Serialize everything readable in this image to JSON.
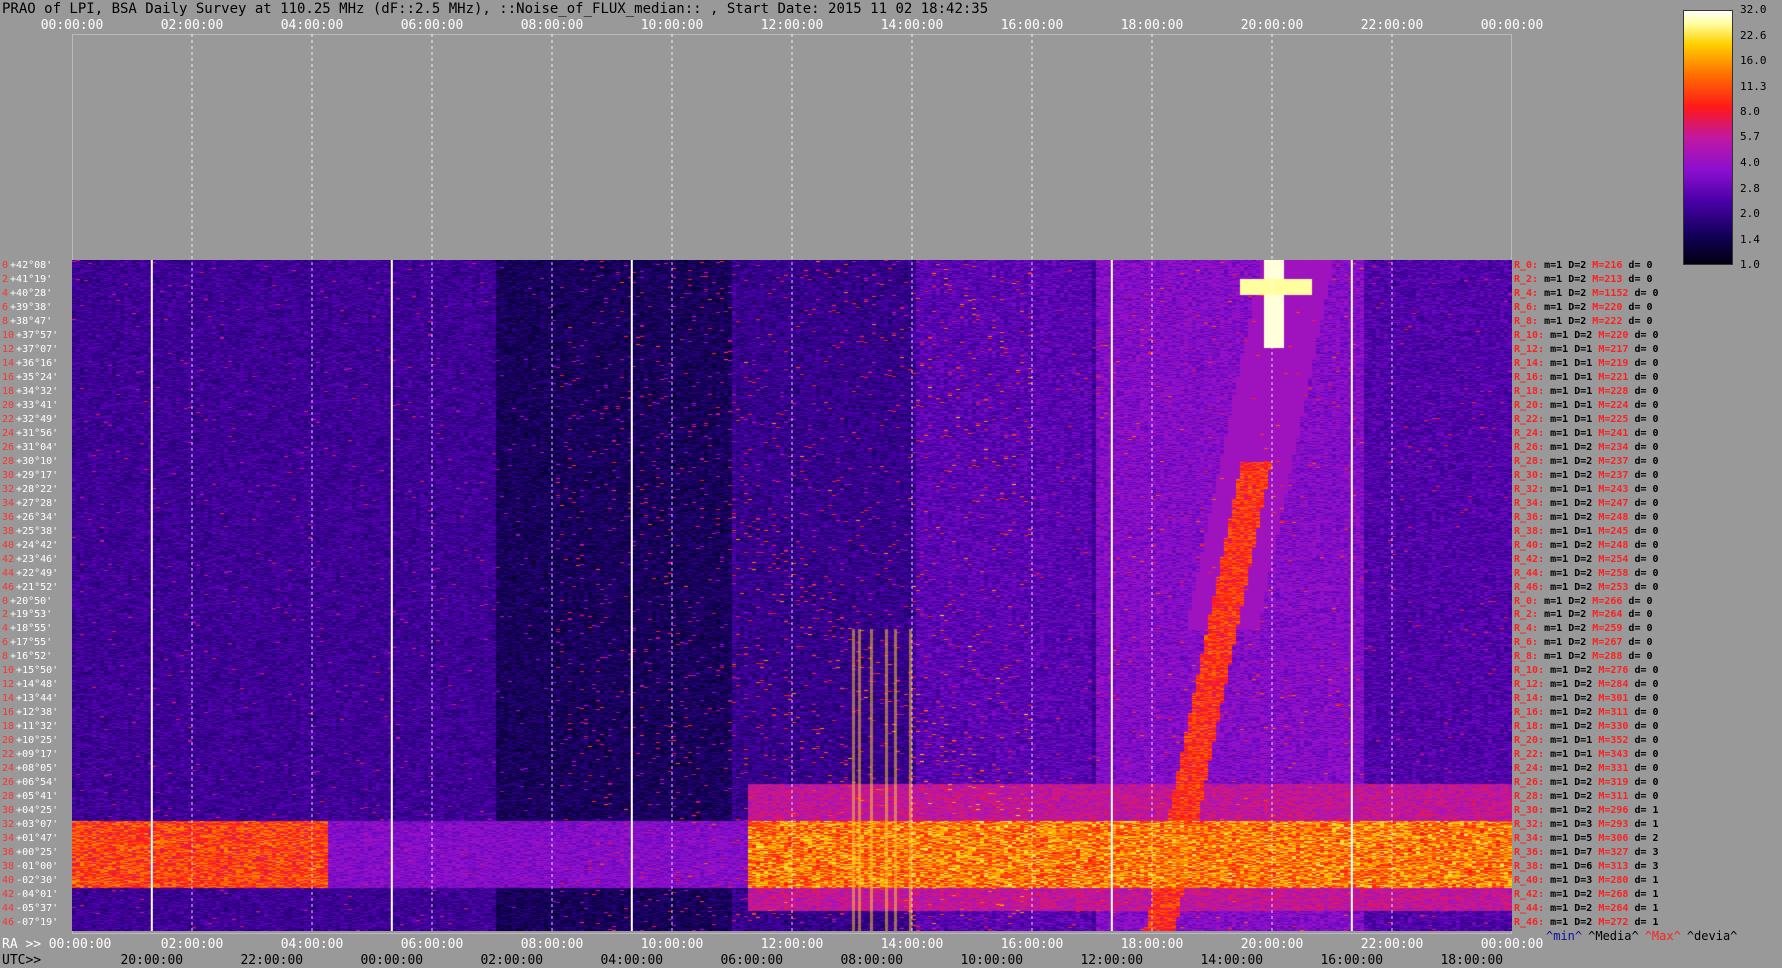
{
  "title": "PRAO of LPI, BSA Daily Survey at 110.25 MHz (dF::2.5 MHz), ::Noise_of_FLUX_median:: , Start Date: 2015 11 02 18:42:35",
  "chart_data": {
    "type": "heatmap",
    "title": "PRAO of LPI, BSA Daily Survey at 110.25 MHz (dF::2.5 MHz), ::Noise_of_FLUX_median:: , Start Date: 2015 11 02 18:42:35",
    "x_top_ticks": [
      "00:00:00",
      "02:00:00",
      "04:00:00",
      "06:00:00",
      "08:00:00",
      "10:00:00",
      "12:00:00",
      "14:00:00",
      "16:00:00",
      "18:00:00",
      "20:00:00",
      "22:00:00",
      "00:00:00"
    ],
    "ra_label": "RA >>",
    "ra_ticks": [
      "00:00:00",
      "02:00:00",
      "04:00:00",
      "06:00:00",
      "08:00:00",
      "10:00:00",
      "12:00:00",
      "14:00:00",
      "16:00:00",
      "18:00:00",
      "20:00:00",
      "22:00:00",
      "00:00:00"
    ],
    "utc_label": "UTC>>",
    "utc_ticks": [
      "20:00:00",
      "22:00:00",
      "00:00:00",
      "02:00:00",
      "04:00:00",
      "06:00:00",
      "08:00:00",
      "10:00:00",
      "12:00:00",
      "14:00:00",
      "16:00:00",
      "18:00:00"
    ],
    "colorbar_ticks": [
      "32.0",
      "22.6",
      "16.0",
      "11.3",
      "8.0",
      "5.7",
      "4.0",
      "2.8",
      "2.0",
      "1.4",
      "1.0"
    ],
    "colorbar_scale": "log",
    "colorbar_range": [
      1.0,
      32.0
    ],
    "rays": [
      {
        "idx": "0",
        "dec": "+42°08'",
        "r": "R_0:",
        "m": "m=1",
        "d": "D=2",
        "mh": "M=216",
        "dv": "d= 0"
      },
      {
        "idx": "2",
        "dec": "+41°19'",
        "r": "R_2:",
        "m": "m=1",
        "d": "D=2",
        "mh": "M=213",
        "dv": "d= 0"
      },
      {
        "idx": "4",
        "dec": "+40°28'",
        "r": "R_4:",
        "m": "m=1",
        "d": "D=2",
        "mh": "M=1152",
        "dv": "d= 0"
      },
      {
        "idx": "6",
        "dec": "+39°38'",
        "r": "R_6:",
        "m": "m=1",
        "d": "D=2",
        "mh": "M=220",
        "dv": "d= 0"
      },
      {
        "idx": "8",
        "dec": "+38°47'",
        "r": "R_8:",
        "m": "m=1",
        "d": "D=2",
        "mh": "M=222",
        "dv": "d= 0"
      },
      {
        "idx": "10",
        "dec": "+37°57'",
        "r": "R_10:",
        "m": "m=1",
        "d": "D=2",
        "mh": "M=220",
        "dv": "d= 0"
      },
      {
        "idx": "12",
        "dec": "+37°07'",
        "r": "R_12:",
        "m": "m=1",
        "d": "D=1",
        "mh": "M=217",
        "dv": "d= 0"
      },
      {
        "idx": "14",
        "dec": "+36°16'",
        "r": "R_14:",
        "m": "m=1",
        "d": "D=1",
        "mh": "M=219",
        "dv": "d= 0"
      },
      {
        "idx": "16",
        "dec": "+35°24'",
        "r": "R_16:",
        "m": "m=1",
        "d": "D=1",
        "mh": "M=221",
        "dv": "d= 0"
      },
      {
        "idx": "18",
        "dec": "+34°32'",
        "r": "R_18:",
        "m": "m=1",
        "d": "D=1",
        "mh": "M=228",
        "dv": "d= 0"
      },
      {
        "idx": "20",
        "dec": "+33°41'",
        "r": "R_20:",
        "m": "m=1",
        "d": "D=1",
        "mh": "M=224",
        "dv": "d= 0"
      },
      {
        "idx": "22",
        "dec": "+32°49'",
        "r": "R_22:",
        "m": "m=1",
        "d": "D=1",
        "mh": "M=225",
        "dv": "d= 0"
      },
      {
        "idx": "24",
        "dec": "+31°56'",
        "r": "R_24:",
        "m": "m=1",
        "d": "D=1",
        "mh": "M=241",
        "dv": "d= 0"
      },
      {
        "idx": "26",
        "dec": "+31°04'",
        "r": "R_26:",
        "m": "m=1",
        "d": "D=2",
        "mh": "M=234",
        "dv": "d= 0"
      },
      {
        "idx": "28",
        "dec": "+30°10'",
        "r": "R_28:",
        "m": "m=1",
        "d": "D=2",
        "mh": "M=237",
        "dv": "d= 0"
      },
      {
        "idx": "30",
        "dec": "+29°17'",
        "r": "R_30:",
        "m": "m=1",
        "d": "D=2",
        "mh": "M=237",
        "dv": "d= 0"
      },
      {
        "idx": "32",
        "dec": "+28°22'",
        "r": "R_32:",
        "m": "m=1",
        "d": "D=1",
        "mh": "M=243",
        "dv": "d= 0"
      },
      {
        "idx": "34",
        "dec": "+27°28'",
        "r": "R_34:",
        "m": "m=1",
        "d": "D=2",
        "mh": "M=247",
        "dv": "d= 0"
      },
      {
        "idx": "36",
        "dec": "+26°34'",
        "r": "R_36:",
        "m": "m=1",
        "d": "D=2",
        "mh": "M=248",
        "dv": "d= 0"
      },
      {
        "idx": "38",
        "dec": "+25°38'",
        "r": "R_38:",
        "m": "m=1",
        "d": "D=1",
        "mh": "M=245",
        "dv": "d= 0"
      },
      {
        "idx": "40",
        "dec": "+24°42'",
        "r": "R_40:",
        "m": "m=1",
        "d": "D=2",
        "mh": "M=248",
        "dv": "d= 0"
      },
      {
        "idx": "42",
        "dec": "+23°46'",
        "r": "R_42:",
        "m": "m=1",
        "d": "D=2",
        "mh": "M=254",
        "dv": "d= 0"
      },
      {
        "idx": "44",
        "dec": "+22°49'",
        "r": "R_44:",
        "m": "m=1",
        "d": "D=2",
        "mh": "M=258",
        "dv": "d= 0"
      },
      {
        "idx": "46",
        "dec": "+21°52'",
        "r": "R_46:",
        "m": "m=1",
        "d": "D=2",
        "mh": "M=253",
        "dv": "d= 0"
      },
      {
        "idx": "0",
        "dec": "+20°50'",
        "r": "R_0:",
        "m": "m=1",
        "d": "D=2",
        "mh": "M=266",
        "dv": "d= 0"
      },
      {
        "idx": "2",
        "dec": "+19°53'",
        "r": "R_2:",
        "m": "m=1",
        "d": "D=2",
        "mh": "M=264",
        "dv": "d= 0"
      },
      {
        "idx": "4",
        "dec": "+18°55'",
        "r": "R_4:",
        "m": "m=1",
        "d": "D=2",
        "mh": "M=259",
        "dv": "d= 0"
      },
      {
        "idx": "6",
        "dec": "+17°55'",
        "r": "R_6:",
        "m": "m=1",
        "d": "D=2",
        "mh": "M=267",
        "dv": "d= 0"
      },
      {
        "idx": "8",
        "dec": "+16°52'",
        "r": "R_8:",
        "m": "m=1",
        "d": "D=2",
        "mh": "M=288",
        "dv": "d= 0"
      },
      {
        "idx": "10",
        "dec": "+15°50'",
        "r": "R_10:",
        "m": "m=1",
        "d": "D=2",
        "mh": "M=276",
        "dv": "d= 0"
      },
      {
        "idx": "12",
        "dec": "+14°48'",
        "r": "R_12:",
        "m": "m=1",
        "d": "D=2",
        "mh": "M=284",
        "dv": "d= 0"
      },
      {
        "idx": "14",
        "dec": "+13°44'",
        "r": "R_14:",
        "m": "m=1",
        "d": "D=2",
        "mh": "M=301",
        "dv": "d= 0"
      },
      {
        "idx": "16",
        "dec": "+12°38'",
        "r": "R_16:",
        "m": "m=1",
        "d": "D=2",
        "mh": "M=311",
        "dv": "d= 0"
      },
      {
        "idx": "18",
        "dec": "+11°32'",
        "r": "R_18:",
        "m": "m=1",
        "d": "D=2",
        "mh": "M=330",
        "dv": "d= 0"
      },
      {
        "idx": "20",
        "dec": "+10°25'",
        "r": "R_20:",
        "m": "m=1",
        "d": "D=1",
        "mh": "M=352",
        "dv": "d= 0"
      },
      {
        "idx": "22",
        "dec": "+09°17'",
        "r": "R_22:",
        "m": "m=1",
        "d": "D=1",
        "mh": "M=343",
        "dv": "d= 0"
      },
      {
        "idx": "24",
        "dec": "+08°05'",
        "r": "R_24:",
        "m": "m=1",
        "d": "D=2",
        "mh": "M=331",
        "dv": "d= 0"
      },
      {
        "idx": "26",
        "dec": "+06°54'",
        "r": "R_26:",
        "m": "m=1",
        "d": "D=2",
        "mh": "M=319",
        "dv": "d= 0"
      },
      {
        "idx": "28",
        "dec": "+05°41'",
        "r": "R_28:",
        "m": "m=1",
        "d": "D=2",
        "mh": "M=311",
        "dv": "d= 0"
      },
      {
        "idx": "30",
        "dec": "+04°25'",
        "r": "R_30:",
        "m": "m=1",
        "d": "D=2",
        "mh": "M=296",
        "dv": "d= 1"
      },
      {
        "idx": "32",
        "dec": "+03°07'",
        "r": "R_32:",
        "m": "m=1",
        "d": "D=3",
        "mh": "M=293",
        "dv": "d= 1"
      },
      {
        "idx": "34",
        "dec": "+01°47'",
        "r": "R_34:",
        "m": "m=1",
        "d": "D=5",
        "mh": "M=306",
        "dv": "d= 2"
      },
      {
        "idx": "36",
        "dec": "+00°25'",
        "r": "R_36:",
        "m": "m=1",
        "d": "D=7",
        "mh": "M=327",
        "dv": "d= 3"
      },
      {
        "idx": "38",
        "dec": "-01°00'",
        "r": "R_38:",
        "m": "m=1",
        "d": "D=6",
        "mh": "M=313",
        "dv": "d= 3"
      },
      {
        "idx": "40",
        "dec": "-02°30'",
        "r": "R_40:",
        "m": "m=1",
        "d": "D=3",
        "mh": "M=280",
        "dv": "d= 1"
      },
      {
        "idx": "42",
        "dec": "-04°01'",
        "r": "R_42:",
        "m": "m=1",
        "d": "D=2",
        "mh": "M=268",
        "dv": "d= 1"
      },
      {
        "idx": "44",
        "dec": "-05°37'",
        "r": "R_44:",
        "m": "m=1",
        "d": "D=2",
        "mh": "M=264",
        "dv": "d= 1"
      },
      {
        "idx": "46",
        "dec": "-07°19'",
        "r": "R_46:",
        "m": "m=1",
        "d": "D=2",
        "mh": "M=272",
        "dv": "d= 1"
      }
    ],
    "legend": [
      {
        "text": "^min^",
        "color": "#1010a0"
      },
      {
        "text": "^Media^",
        "color": "#000000"
      },
      {
        "text": "^Max^",
        "color": "#ff2020"
      },
      {
        "text": "^devia^",
        "color": "#000000"
      }
    ],
    "solid_vertical_markers_x_hours": [
      1.33,
      5.33,
      9.33,
      17.33,
      21.33
    ],
    "dashed_vertical_markers_x_hours": [
      2,
      4,
      6,
      8,
      10,
      12,
      14,
      16,
      18,
      20,
      22
    ]
  }
}
